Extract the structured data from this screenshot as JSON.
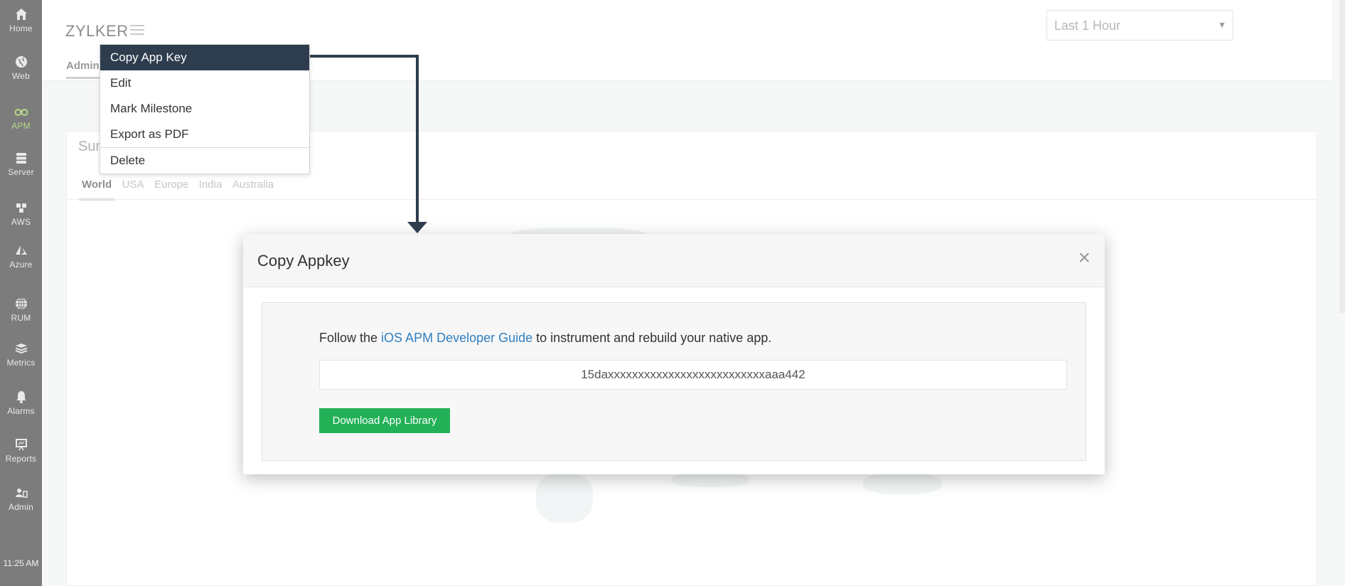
{
  "sidebar": {
    "items": [
      {
        "label": "Home",
        "icon": "home-icon"
      },
      {
        "label": "Web",
        "icon": "globe-icon"
      },
      {
        "label": "APM",
        "icon": "binoculars-icon",
        "active": true
      },
      {
        "label": "Server",
        "icon": "server-icon"
      },
      {
        "label": "AWS",
        "icon": "aws-icon"
      },
      {
        "label": "Azure",
        "icon": "azure-icon"
      },
      {
        "label": "RUM",
        "icon": "globe-grid-icon"
      },
      {
        "label": "Metrics",
        "icon": "stack-icon"
      },
      {
        "label": "Alarms",
        "icon": "bell-icon"
      },
      {
        "label": "Reports",
        "icon": "presentation-icon"
      },
      {
        "label": "Admin",
        "icon": "admin-icon"
      }
    ],
    "time": "11:25 AM"
  },
  "header": {
    "brand": "ZYLKER",
    "tab": "Admin",
    "time_range": "Last 1 Hour"
  },
  "panel": {
    "title": "Sum",
    "regions": [
      "World",
      "USA",
      "Europe",
      "India",
      "Australia"
    ]
  },
  "context_menu": {
    "items": [
      "Copy App Key",
      "Edit",
      "Mark Milestone",
      "Export as PDF",
      "Delete"
    ]
  },
  "modal": {
    "title": "Copy Appkey",
    "close": "×",
    "text_before": "Follow the ",
    "link": "iOS APM Developer Guide",
    "text_after": " to instrument and rebuild your native app.",
    "app_key": "15daxxxxxxxxxxxxxxxxxxxxxxxxxxaaa442",
    "download_label": "Download App Library"
  },
  "colors": {
    "sidebar": "#7c7c7c",
    "menu_highlight": "#2e3d4e",
    "download_button": "#22b157",
    "link": "#2f7fc1",
    "active_nav": "#b5d88a"
  }
}
